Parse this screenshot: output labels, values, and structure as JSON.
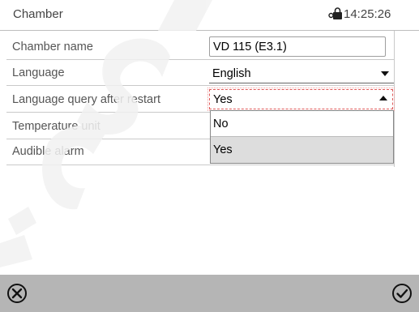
{
  "header": {
    "title": "Chamber",
    "lock_icon": "lock-key-icon",
    "time": "14:25:26"
  },
  "rows": [
    {
      "label": "Chamber name"
    },
    {
      "label": "Language"
    },
    {
      "label": "Language query after restart"
    },
    {
      "label": "Temperature unit"
    },
    {
      "label": "Audible alarm"
    }
  ],
  "fields": {
    "chamber_name_value": "VD 115 (E3.1)",
    "language_value": "English",
    "language_query_value": "Yes",
    "dropdown_options": [
      "No",
      "Yes"
    ],
    "dropdown_selected": "Yes"
  },
  "footer": {
    "cancel_icon": "cancel-circle-x-icon",
    "confirm_icon": "confirm-circle-check-icon"
  },
  "colors": {
    "footer_bg": "#b5b5b5",
    "focus_border": "#e05a5a",
    "selected_option_bg": "#dddddd"
  }
}
